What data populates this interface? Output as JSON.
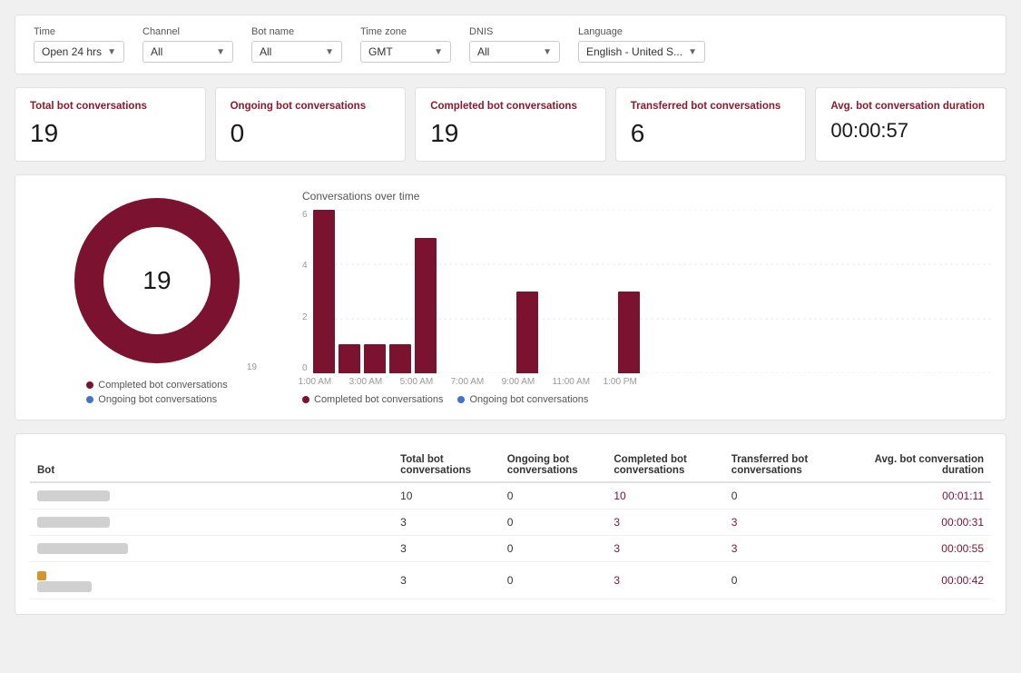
{
  "filters": {
    "time_label": "Time",
    "time_value": "Open 24 hrs",
    "channel_label": "Channel",
    "channel_value": "All",
    "bot_name_label": "Bot name",
    "bot_name_value": "All",
    "timezone_label": "Time zone",
    "timezone_value": "GMT",
    "dnis_label": "DNIS",
    "dnis_value": "All",
    "language_label": "Language",
    "language_value": "English - United S..."
  },
  "kpis": {
    "total_label": "Total bot conversations",
    "total_value": "19",
    "ongoing_label": "Ongoing bot conversations",
    "ongoing_value": "0",
    "completed_label": "Completed bot conversations",
    "completed_value": "19",
    "transferred_label": "Transferred bot conversations",
    "transferred_value": "6",
    "avg_label": "Avg. bot conversation duration",
    "avg_value": "00:00:57"
  },
  "donut": {
    "center_value": "19",
    "legend_completed": "Completed bot conversations",
    "legend_ongoing": "Ongoing bot conversations",
    "completed_label": "19"
  },
  "bar_chart": {
    "title": "Conversations over time",
    "y_labels": [
      "6",
      "4",
      "2",
      "0"
    ],
    "bars": [
      {
        "height_pct": 100,
        "label": "1:00 AM"
      },
      {
        "height_pct": 18,
        "label": ""
      },
      {
        "height_pct": 18,
        "label": "3:00 AM"
      },
      {
        "height_pct": 18,
        "label": ""
      },
      {
        "height_pct": 83,
        "label": "5:00 AM"
      },
      {
        "height_pct": 0,
        "label": ""
      },
      {
        "height_pct": 0,
        "label": "7:00 AM"
      },
      {
        "height_pct": 0,
        "label": ""
      },
      {
        "height_pct": 50,
        "label": "9:00 AM"
      },
      {
        "height_pct": 0,
        "label": ""
      },
      {
        "height_pct": 0,
        "label": "11:00 AM"
      },
      {
        "height_pct": 0,
        "label": ""
      },
      {
        "height_pct": 50,
        "label": "1:00 PM"
      }
    ],
    "legend_completed": "Completed bot conversations",
    "legend_ongoing": "Ongoing bot conversations"
  },
  "table": {
    "col_bot": "Bot",
    "col_total": "Total bot conversations",
    "col_ongoing": "Ongoing bot conversations",
    "col_completed": "Completed bot conversations",
    "col_transferred": "Transferred bot conversations",
    "col_avg": "Avg. bot conversation duration",
    "rows": [
      {
        "bot": "",
        "total": "10",
        "ongoing": "0",
        "completed": "10",
        "transferred": "0",
        "avg": "00:01:11",
        "name_width": "80"
      },
      {
        "bot": "",
        "total": "3",
        "ongoing": "0",
        "completed": "3",
        "transferred": "3",
        "avg": "00:00:31",
        "name_width": "80"
      },
      {
        "bot": "",
        "total": "3",
        "ongoing": "0",
        "completed": "3",
        "transferred": "3",
        "avg": "00:00:55",
        "name_width": "100"
      },
      {
        "bot": "",
        "total": "3",
        "ongoing": "0",
        "completed": "3",
        "transferred": "0",
        "avg": "00:00:42",
        "name_width": "60"
      }
    ]
  },
  "colors": {
    "accent": "#7b1230",
    "ongoing": "#4472c4"
  }
}
